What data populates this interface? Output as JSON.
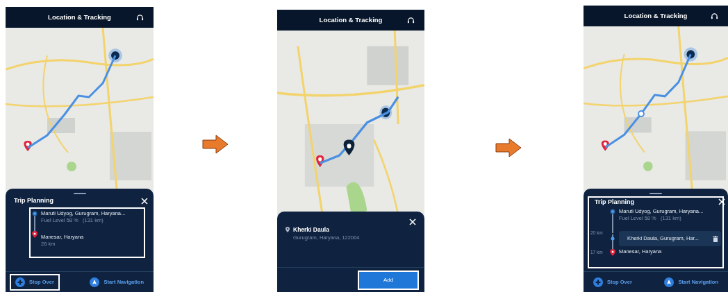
{
  "screens": [
    {
      "title": "Location & Tracking",
      "map": {
        "kind": "wide",
        "waypoint": false,
        "dropped_pin": false
      },
      "panel": {
        "kind": "trip",
        "title": "Trip Planning",
        "stops_highlighted": true,
        "title_highlighted": false,
        "stops": [
          {
            "kind": "origin",
            "name": "Maruti Udyog, Gurugram, Haryana...",
            "detail": "Fuel Level 58 %   (131 km)"
          },
          {
            "kind": "destination",
            "name": "Manesar, Haryana",
            "detail": "26 km"
          }
        ],
        "buttons": [
          {
            "kind": "stop_over",
            "label": "Stop Over",
            "highlighted": true
          },
          {
            "kind": "navigate",
            "label": "Start Navigation",
            "highlighted": false
          }
        ]
      }
    },
    {
      "title": "Location & Tracking",
      "map": {
        "kind": "zoomed",
        "waypoint": false,
        "dropped_pin": true
      },
      "panel": {
        "kind": "place",
        "name": "Kherki Daula",
        "address": "Gurugram, Haryana, 122004",
        "button": {
          "label": "Add",
          "highlighted": true
        }
      }
    },
    {
      "title": "Location & Tracking",
      "map": {
        "kind": "wide",
        "waypoint": true,
        "dropped_pin": false
      },
      "panel": {
        "kind": "trip",
        "title": "Trip Planning",
        "stops_highlighted": true,
        "title_highlighted": true,
        "stops": [
          {
            "kind": "origin",
            "name": "Maruti Udyog, Gurugram, Haryana...",
            "detail": "Fuel Level 58 %   (131 km)"
          },
          {
            "kind": "stopover",
            "name": "Kherki Daula, Gurugram, Har...",
            "leg": "20 km"
          },
          {
            "kind": "destination",
            "name": "Manesar, Haryana",
            "leg": "17 km"
          }
        ],
        "buttons": [
          {
            "kind": "stop_over",
            "label": "Stop Over",
            "highlighted": false
          },
          {
            "kind": "navigate",
            "label": "Start Navigation",
            "highlighted": false
          }
        ]
      }
    }
  ]
}
